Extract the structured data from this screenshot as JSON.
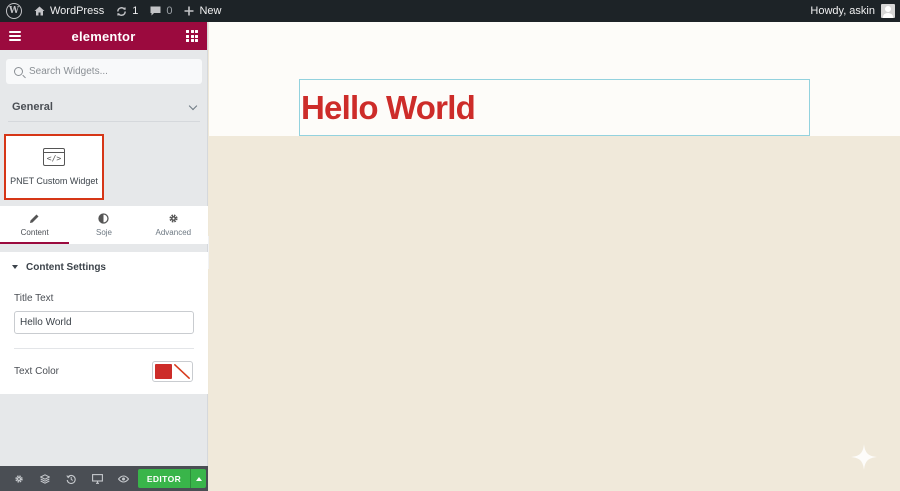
{
  "adminbar": {
    "site_name": "WordPress",
    "updates_count": "1",
    "comments_count": "0",
    "new_label": "New",
    "greeting": "Howdy, askin"
  },
  "panel": {
    "brand": "elementor",
    "search_placeholder": "Search Widgets...",
    "category": "General",
    "widget_label": "PNET Custom Widget",
    "tabs": [
      {
        "label": "Content",
        "icon": "pencil-icon"
      },
      {
        "label": "Soje",
        "icon": "half-circle-icon"
      },
      {
        "label": "Advanced",
        "icon": "gear-icon"
      }
    ],
    "section_title": "Content Settings",
    "title_text_label": "Title Text",
    "title_text_value": "Hello World",
    "text_color_label": "Text Color",
    "text_color_value": "#cd2c29"
  },
  "footer": {
    "editor_label": "EDITOR"
  },
  "canvas": {
    "heading": "Hello World"
  },
  "colors": {
    "panel_header": "#9b0a3e",
    "heading_red": "#cd2c29",
    "editor_green": "#39b54a",
    "highlight_border": "#d63617"
  }
}
